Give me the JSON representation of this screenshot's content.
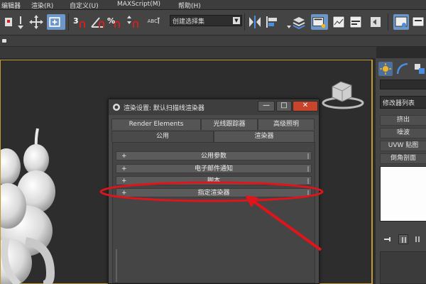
{
  "menubar": {
    "items": [
      {
        "label": "编辑器"
      },
      {
        "label": "渲染(R)"
      },
      {
        "label": "自定义(U)"
      },
      {
        "label": "MAXScript(M)"
      },
      {
        "label": "帮助(H)"
      }
    ]
  },
  "toolbar": {
    "snap_labels": [
      "3",
      "%",
      "%"
    ],
    "named_selection": {
      "value": "创建选择集"
    }
  },
  "dialog": {
    "title": "渲染设置: 默认扫描线渲染器",
    "close_glyph": "✕",
    "minimize_glyph": "—",
    "maximize_glyph": "□",
    "tabs_row1": [
      {
        "label": "Render Elements"
      },
      {
        "label": "光线跟踪器"
      },
      {
        "label": "高级照明"
      }
    ],
    "tabs_row2": [
      {
        "label": "公用",
        "active": true
      },
      {
        "label": "渲染器"
      }
    ],
    "rollouts": [
      {
        "symbol": "+",
        "label": "公用参数"
      },
      {
        "symbol": "+",
        "label": "电子邮件通知"
      },
      {
        "symbol": "+",
        "label": "脚本"
      },
      {
        "symbol": "+",
        "label": "指定渲染器"
      }
    ]
  },
  "command_panel": {
    "modifier_list": "修改器列表",
    "modifier_buttons": [
      {
        "label": "挤出"
      },
      {
        "label": "噪波"
      },
      {
        "label": "UVW 贴图"
      },
      {
        "label": "倒角剖面"
      }
    ]
  },
  "colors": {
    "viewport_border": "#bf9a3a",
    "active_button": "#6e97c9",
    "annotation": "#e0141a"
  },
  "icons": [
    "transform-gizmo-icon",
    "snap-toggle-icon",
    "angle-snap-icon",
    "percent-snap-icon",
    "mirror-icon",
    "align-icon",
    "layer-icon",
    "render-setup-icon",
    "rendered-frame-icon",
    "render-icon",
    "viewcube-icon",
    "sun-icon",
    "curve-icon"
  ]
}
